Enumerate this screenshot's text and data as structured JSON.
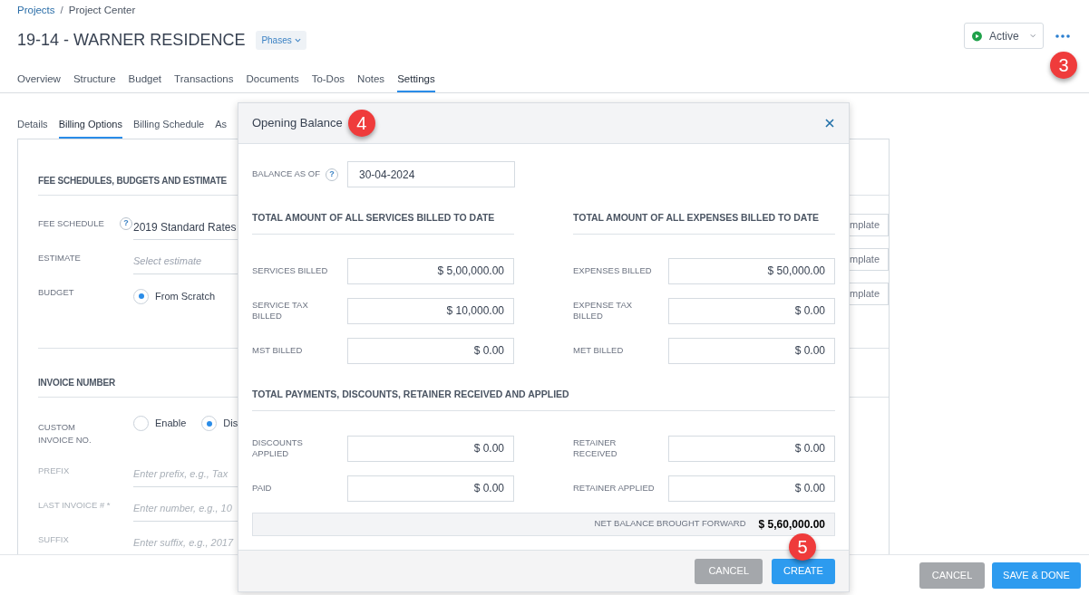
{
  "breadcrumb": {
    "items": [
      {
        "label": "Projects",
        "link": true
      },
      {
        "label": "Project Center",
        "link": false
      }
    ],
    "separator": "/"
  },
  "project": {
    "title": "19-14 - WARNER RESIDENCE",
    "phases_button": "Phases"
  },
  "status": {
    "label": "Active",
    "annotation": "3"
  },
  "tabs": [
    {
      "label": "Overview",
      "selected": false
    },
    {
      "label": "Structure",
      "selected": false
    },
    {
      "label": "Budget",
      "selected": false
    },
    {
      "label": "Transactions",
      "selected": false
    },
    {
      "label": "Documents",
      "selected": false
    },
    {
      "label": "To-Dos",
      "selected": false
    },
    {
      "label": "Notes",
      "selected": false
    },
    {
      "label": "Settings",
      "selected": true
    }
  ],
  "subtabs": [
    {
      "label": "Details",
      "selected": false
    },
    {
      "label": "Billing Options",
      "selected": true
    },
    {
      "label": "Billing Schedule",
      "selected": false
    },
    {
      "label": "As",
      "selected": false
    }
  ],
  "sections": [
    {
      "title": "FEE SCHEDULES, BUDGETS AND ESTIMATE",
      "rows": [
        {
          "kind": "select",
          "label": "FEE SCHEDULE",
          "help": "?",
          "value": "2019 Standard Rates",
          "side_button": "mplate",
          "disabled": false
        },
        {
          "kind": "select",
          "label": "ESTIMATE",
          "placeholder": "Select estimate",
          "side_button": "mplate",
          "disabled": false
        },
        {
          "kind": "radio",
          "label": "BUDGET",
          "options": [
            {
              "label": "From Scratch",
              "selected": true
            }
          ],
          "side_button": "mplate",
          "disabled": false
        }
      ]
    },
    {
      "title": "INVOICE NUMBER",
      "rows": [
        {
          "kind": "radio",
          "label": "CUSTOM INVOICE NO.",
          "options": [
            {
              "label": "Enable",
              "selected": false
            },
            {
              "label": "Dis",
              "selected": true
            }
          ],
          "disabled": false
        },
        {
          "kind": "text",
          "label": "PREFIX",
          "placeholder": "Enter prefix, e.g., Tax",
          "disabled": true
        },
        {
          "kind": "text",
          "label": "LAST INVOICE # *",
          "placeholder": "Enter number, e.g., 10",
          "disabled": true
        },
        {
          "kind": "text",
          "label": "SUFFIX",
          "placeholder": "Enter suffix, e.g., 2017",
          "disabled": true
        }
      ]
    }
  ],
  "footer": {
    "cancel": "CANCEL",
    "save": "SAVE & DONE"
  },
  "modal": {
    "title": "Opening Balance",
    "annotation": "4",
    "balance_as_of": {
      "label": "BALANCE AS OF",
      "help": "?",
      "value": "30-04-2024"
    },
    "groups": [
      {
        "title": "TOTAL AMOUNT OF ALL SERVICES BILLED TO DATE",
        "fields": [
          {
            "label": "SERVICES BILLED",
            "value": "$ 5,00,000.00"
          },
          {
            "label": "SERVICE TAX BILLED",
            "value": "$ 10,000.00"
          },
          {
            "label": "MST BILLED",
            "value": "$ 0.00"
          }
        ]
      },
      {
        "title": "TOTAL AMOUNT OF ALL EXPENSES BILLED TO DATE",
        "fields": [
          {
            "label": "EXPENSES BILLED",
            "value": "$ 50,000.00"
          },
          {
            "label": "EXPENSE TAX BILLED",
            "value": "$ 0.00"
          },
          {
            "label": "MET BILLED",
            "value": "$ 0.00"
          }
        ]
      }
    ],
    "payments": {
      "title": "TOTAL PAYMENTS, DISCOUNTS, RETAINER RECEIVED AND APPLIED",
      "fields": [
        {
          "label": "DISCOUNTS APPLIED",
          "value": "$ 0.00"
        },
        {
          "label": "RETAINER RECEIVED",
          "value": "$ 0.00"
        },
        {
          "label": "PAID",
          "value": "$ 0.00"
        },
        {
          "label": "RETAINER APPLIED",
          "value": "$ 0.00"
        }
      ]
    },
    "net": {
      "label": "NET BALANCE BROUGHT FORWARD",
      "value": "$ 5,60,000.00"
    },
    "cancel": "CANCEL",
    "create": "CREATE",
    "create_annotation": "5"
  }
}
